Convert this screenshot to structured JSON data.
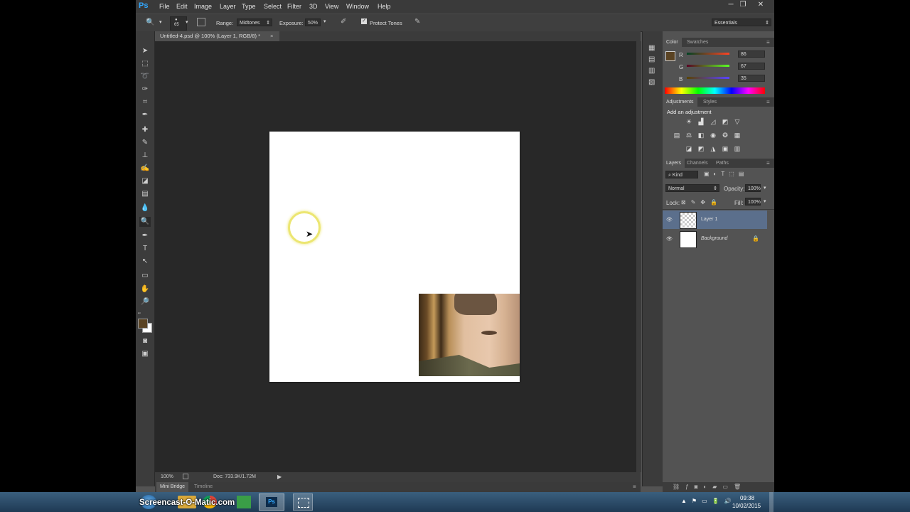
{
  "app": {
    "logo": "Ps",
    "menu": [
      "File",
      "Edit",
      "Image",
      "Layer",
      "Type",
      "Select",
      "Filter",
      "3D",
      "View",
      "Window",
      "Help"
    ],
    "window_controls": [
      "─",
      "❐",
      "✕"
    ]
  },
  "options": {
    "brush_size": "65",
    "range_label": "Range:",
    "range_value": "Midtones",
    "exposure_label": "Exposure:",
    "exposure_value": "50%",
    "protect_tones_label": "Protect Tones",
    "protect_tones_checked": true,
    "workspace": "Essentials"
  },
  "document": {
    "tab_title": "Untitled-4.psd @ 100% (Layer 1, RGB/8) *",
    "tab_close": "×",
    "zoom": "100%",
    "doc_info": "Doc: 733.9K/1.72M",
    "photo_description": "portrait of a young man"
  },
  "bottom_tabs": [
    "Mini Bridge",
    "Timeline"
  ],
  "color_panel": {
    "tabs": [
      "Color",
      "Swatches"
    ],
    "foreground": "#5a4323",
    "background": "#ffffff",
    "channels": [
      {
        "label": "R",
        "value": "86"
      },
      {
        "label": "G",
        "value": "67"
      },
      {
        "label": "B",
        "value": "35"
      }
    ]
  },
  "adjustments_panel": {
    "tabs": [
      "Adjustments",
      "Styles"
    ],
    "heading": "Add an adjustment"
  },
  "layers_panel": {
    "tabs": [
      "Layers",
      "Channels",
      "Paths"
    ],
    "kind_label": "Kind",
    "blend_mode": "Normal",
    "opacity_label": "Opacity:",
    "opacity_value": "100%",
    "lock_label": "Lock:",
    "fill_label": "Fill:",
    "fill_value": "100%",
    "layers": [
      {
        "name": "Layer 1",
        "selected": true
      },
      {
        "name": "Background",
        "selected": false,
        "locked": true
      }
    ]
  },
  "taskbar": {
    "watermark": "Screencast-O-Matic.com",
    "time": "09:38",
    "date": "10/02/2015"
  }
}
